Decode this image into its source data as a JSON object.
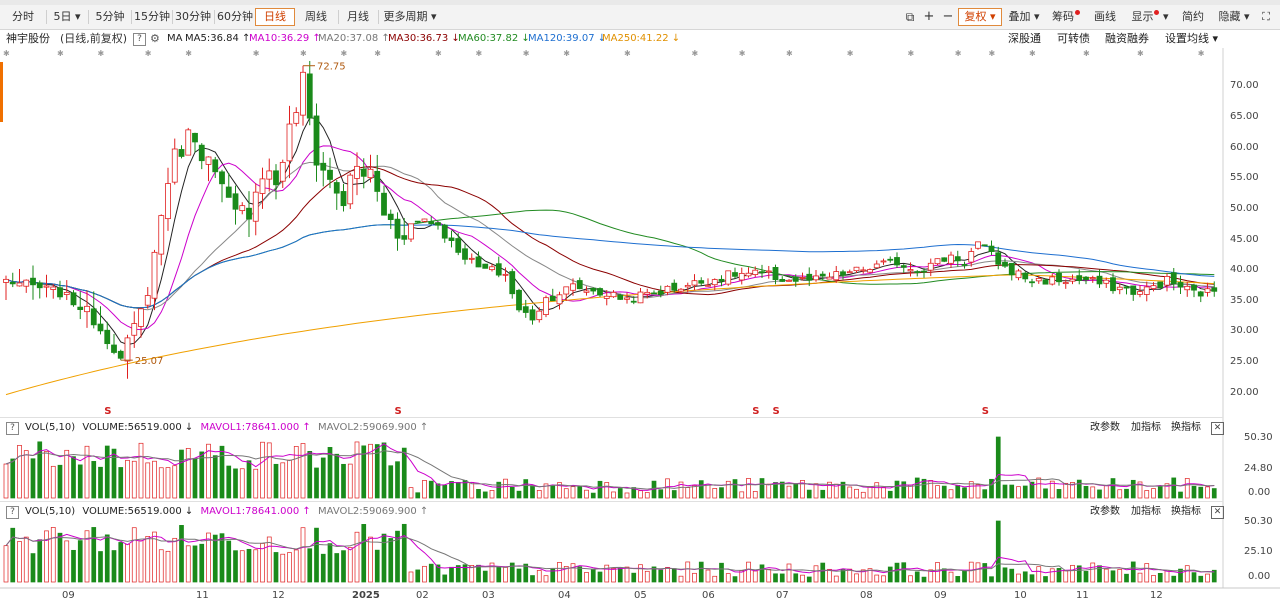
{
  "toolbar": {
    "periods": [
      "分时",
      "5日",
      "5分钟",
      "15分钟",
      "30分钟",
      "60分钟",
      "日线",
      "周线",
      "月线",
      "更多周期"
    ],
    "selected": "日线",
    "right": [
      "复权",
      "叠加",
      "筹码",
      "画线",
      "显示",
      "简约",
      "隐藏"
    ]
  },
  "info": {
    "stock": "神宇股份",
    "mode": "(日线,前复权)",
    "help": "?",
    "ma_label": "MA",
    "ma5": "MA5:36.84",
    "ma10": "MA10:36.29",
    "ma20": "MA20:37.08",
    "ma30": "MA30:36.73",
    "ma60": "MA60:37.82",
    "ma120": "MA120:39.07",
    "ma250": "MA250:41.22",
    "links": [
      "深股通",
      "可转债",
      "融资融券",
      "设置均线"
    ]
  },
  "price_axis": [
    "70.00",
    "65.00",
    "60.00",
    "55.00",
    "50.00",
    "45.00",
    "40.00",
    "35.00",
    "30.00",
    "25.00",
    "20.00"
  ],
  "annotations": {
    "high": "72.75",
    "low": "25.07",
    "markers": [
      "S",
      "S",
      "S",
      "S",
      "S"
    ]
  },
  "vol1": {
    "title": "VOL(5,10)",
    "volume": "VOLUME:56519.000",
    "mavol1": "MAVOL1:78641.000",
    "mavol2": "MAVOL2:59069.900",
    "axis": [
      "50.30",
      "24.80",
      "0.00"
    ],
    "buttons": [
      "改参数",
      "加指标",
      "换指标"
    ]
  },
  "vol2": {
    "title": "VOL(5,10)",
    "volume": "VOLUME:56519.000",
    "mavol1": "MAVOL1:78641.000",
    "mavol2": "MAVOL2:59069.900",
    "axis": [
      "50.30",
      "25.10",
      "0.00"
    ],
    "buttons": [
      "改参数",
      "加指标",
      "换指标"
    ]
  },
  "time_axis": [
    "09",
    "11",
    "12",
    "2025",
    "02",
    "03",
    "04",
    "05",
    "06",
    "07",
    "08",
    "09",
    "10",
    "11",
    "12"
  ],
  "colors": {
    "up": "#e02020",
    "down": "#1a8a1a",
    "ma5": "#222222",
    "ma10": "#cc00cc",
    "ma20": "#888888",
    "ma30": "#8b0000",
    "ma60": "#228b22",
    "ma120": "#1e6fd0",
    "ma250": "#f0a000"
  },
  "chart_data": {
    "type": "candlestick",
    "title": "神宇股份",
    "subtitle": "(日线,前复权)",
    "ylim": [
      17,
      74
    ],
    "close_series": {
      "x_months": [
        "09",
        "11",
        "12",
        "2025",
        "02",
        "03",
        "04",
        "05",
        "06",
        "07",
        "08",
        "09",
        "10",
        "11",
        "12"
      ],
      "months_x": [
        0,
        22,
        36,
        44,
        52,
        62,
        77,
        84,
        97,
        111,
        125,
        138,
        151,
        165,
        178
      ],
      "anchors": [
        [
          0,
          38
        ],
        [
          8,
          36
        ],
        [
          12,
          33
        ],
        [
          14,
          30
        ],
        [
          16,
          27
        ],
        [
          17,
          25.1
        ],
        [
          18,
          28
        ],
        [
          20,
          33
        ],
        [
          22,
          42
        ],
        [
          24,
          55
        ],
        [
          26,
          60
        ],
        [
          28,
          62
        ],
        [
          30,
          57
        ],
        [
          32,
          52
        ],
        [
          34,
          48
        ],
        [
          36,
          50
        ],
        [
          38,
          56
        ],
        [
          40,
          54
        ],
        [
          42,
          62
        ],
        [
          44,
          70
        ],
        [
          46,
          58
        ],
        [
          48,
          54
        ],
        [
          50,
          51
        ],
        [
          52,
          56
        ],
        [
          54,
          55
        ],
        [
          56,
          49
        ],
        [
          58,
          46
        ],
        [
          62,
          48
        ],
        [
          64,
          47
        ],
        [
          66,
          44
        ],
        [
          68,
          42
        ],
        [
          70,
          40
        ],
        [
          74,
          39
        ],
        [
          76,
          33
        ],
        [
          78,
          32
        ],
        [
          80,
          35
        ],
        [
          84,
          37
        ],
        [
          88,
          36
        ],
        [
          92,
          35
        ],
        [
          96,
          36
        ],
        [
          100,
          37
        ],
        [
          104,
          38
        ],
        [
          108,
          39
        ],
        [
          112,
          39
        ],
        [
          116,
          38
        ],
        [
          120,
          38
        ],
        [
          124,
          39
        ],
        [
          128,
          40
        ],
        [
          132,
          41
        ],
        [
          134,
          40
        ],
        [
          136,
          40
        ],
        [
          138,
          41
        ],
        [
          140,
          42
        ],
        [
          142,
          41
        ],
        [
          144,
          44
        ],
        [
          146,
          42
        ],
        [
          148,
          40
        ],
        [
          150,
          39
        ],
        [
          152,
          38
        ],
        [
          156,
          38
        ],
        [
          160,
          38
        ],
        [
          164,
          37
        ],
        [
          168,
          36
        ],
        [
          170,
          37
        ],
        [
          172,
          38
        ],
        [
          174,
          37
        ],
        [
          176,
          36
        ],
        [
          178,
          36
        ],
        [
          180,
          37
        ]
      ]
    },
    "ma_values": {
      "MA5": 36.84,
      "MA10": 36.29,
      "MA20": 37.08,
      "MA30": 36.73,
      "MA60": 37.82,
      "MA120": 39.07,
      "MA250": 41.22
    },
    "high": 72.75,
    "low": 25.07,
    "volume": {
      "VOLUME": 56519.0,
      "MAVOL1": 78641.0,
      "MAVOL2": 59069.9
    }
  }
}
